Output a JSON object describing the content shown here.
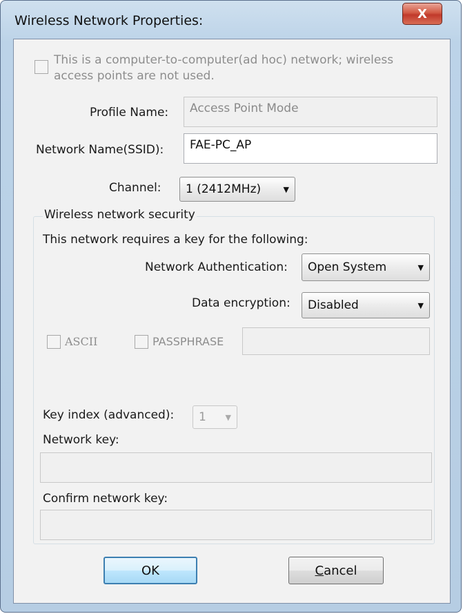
{
  "window": {
    "title": "Wireless Network Properties:",
    "close_label": "X"
  },
  "adhoc": {
    "line1": "This is a computer-to-computer(ad hoc) network; wireless",
    "line2": "access points are not used."
  },
  "profile": {
    "label": "Profile Name:",
    "value": "Access Point Mode"
  },
  "ssid": {
    "label": "Network Name(SSID):",
    "value": "FAE-PC_AP"
  },
  "channel": {
    "label": "Channel:",
    "value": "1  (2412MHz)"
  },
  "security": {
    "group_title": "Wireless network security",
    "requires_text": "This network requires a key for the following:",
    "auth_label": "Network Authentication:",
    "auth_value": "Open System",
    "encryption_label": "Data encryption:",
    "encryption_value": "Disabled",
    "ascii_label": "ASCII",
    "passphrase_label": "PASSPHRASE",
    "key_index_label": "Key index (advanced):",
    "key_index_value": "1",
    "network_key_label": "Network key:",
    "confirm_key_label": "Confirm network key:"
  },
  "buttons": {
    "ok": "OK",
    "cancel_first": "C",
    "cancel_rest": "ancel"
  }
}
